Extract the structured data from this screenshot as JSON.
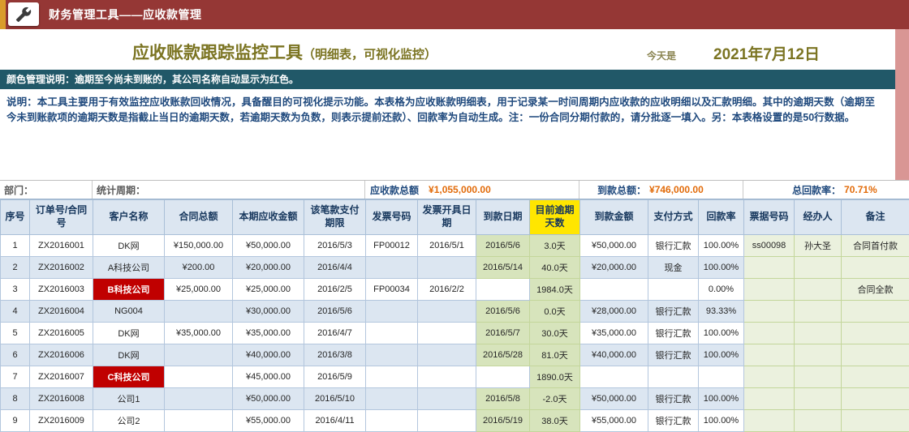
{
  "colors": {
    "topbar_bg": "#953735",
    "topbar_accent": "#D99C2B",
    "olive": "#7B7422",
    "teal": "#215868",
    "navy": "#1F497D",
    "orange": "#E26B0A",
    "header_bg": "#DCE6F1",
    "header_text": "#17375D",
    "overdue_yellow": "#FFE600",
    "stripe": "#DCE6F1",
    "green_dark": "#D7E4BC",
    "green_light": "#EBF1DE",
    "red_cell": "#C00000",
    "salmon": "#D99694"
  },
  "topbar": {
    "icon": "wrench-icon",
    "title": "财务管理工具——应收款管理"
  },
  "header": {
    "title_main": "应收账款跟踪监控工具",
    "title_sub": "（明细表，可视化监控）",
    "today_label": "今天是",
    "date": "2021年7月12日"
  },
  "note_bar": "颜色管理说明：逾期至今尚未到账的，其公司名称自动显示为红色。",
  "description": "说明：本工具主要用于有效监控应收账款回收情况，具备醒目的可视化提示功能。本表格为应收账款明细表，用于记录某一时间周期内应收款的应收明细以及汇款明细。其中的逾期天数（逾期至今未到账款项的逾期天数是指截止当日的逾期天数，若逾期天数为负数，则表示提前还款）、回款率为自动生成。注：一份合同分期付款的，请分批逐一填入。另：本表格设置的是50行数据。",
  "summary": {
    "department_label": "部门：",
    "period_label": "统计周期：",
    "receivable_total_label": "应收款总额",
    "receivable_total_value": "¥1,055,000.00",
    "received_total_label": "到款总额：",
    "received_total_value": "¥746,000.00",
    "collection_rate_label": "总回款率：",
    "collection_rate_value": "70.71%"
  },
  "table": {
    "headers": [
      "序号",
      "订单号/合同号",
      "客户名称",
      "合同总额",
      "本期应收金额",
      "该笔款支付期限",
      "发票号码",
      "发票开具日期",
      "到款日期",
      "目前逾期天数",
      "到款金额",
      "支付方式",
      "回款率",
      "票据号码",
      "经办人",
      "备注"
    ],
    "rows": [
      {
        "cells": [
          "1",
          "ZX2016001",
          "DK网",
          "¥150,000.00",
          "¥50,000.00",
          "2016/5/3",
          "FP00012",
          "2016/5/1",
          "2016/5/6",
          "3.0天",
          "¥50,000.00",
          "银行汇款",
          "100.00%",
          "ss00098",
          "孙大圣",
          "合同首付款"
        ],
        "customer_red": false
      },
      {
        "cells": [
          "2",
          "ZX2016002",
          "A科技公司",
          "¥200.00",
          "¥20,000.00",
          "2016/4/4",
          "",
          "",
          "2016/5/14",
          "40.0天",
          "¥20,000.00",
          "现金",
          "100.00%",
          "",
          "",
          ""
        ],
        "customer_red": false
      },
      {
        "cells": [
          "3",
          "ZX2016003",
          "B科技公司",
          "¥25,000.00",
          "¥25,000.00",
          "2016/2/5",
          "FP00034",
          "2016/2/2",
          "",
          "1984.0天",
          "",
          "",
          "0.00%",
          "",
          "",
          "合同全款"
        ],
        "customer_red": true
      },
      {
        "cells": [
          "4",
          "ZX2016004",
          "NG004",
          "",
          "¥30,000.00",
          "2016/5/6",
          "",
          "",
          "2016/5/6",
          "0.0天",
          "¥28,000.00",
          "银行汇款",
          "93.33%",
          "",
          "",
          ""
        ],
        "customer_red": false
      },
      {
        "cells": [
          "5",
          "ZX2016005",
          "DK网",
          "¥35,000.00",
          "¥35,000.00",
          "2016/4/7",
          "",
          "",
          "2016/5/7",
          "30.0天",
          "¥35,000.00",
          "银行汇款",
          "100.00%",
          "",
          "",
          ""
        ],
        "customer_red": false
      },
      {
        "cells": [
          "6",
          "ZX2016006",
          "DK网",
          "",
          "¥40,000.00",
          "2016/3/8",
          "",
          "",
          "2016/5/28",
          "81.0天",
          "¥40,000.00",
          "银行汇款",
          "100.00%",
          "",
          "",
          ""
        ],
        "customer_red": false
      },
      {
        "cells": [
          "7",
          "ZX2016007",
          "C科技公司",
          "",
          "¥45,000.00",
          "2016/5/9",
          "",
          "",
          "",
          "1890.0天",
          "",
          "",
          "",
          "",
          "",
          ""
        ],
        "customer_red": true
      },
      {
        "cells": [
          "8",
          "ZX2016008",
          "公司1",
          "",
          "¥50,000.00",
          "2016/5/10",
          "",
          "",
          "2016/5/8",
          "-2.0天",
          "¥50,000.00",
          "银行汇款",
          "100.00%",
          "",
          "",
          ""
        ],
        "customer_red": false
      },
      {
        "cells": [
          "9",
          "ZX2016009",
          "公司2",
          "",
          "¥55,000.00",
          "2016/4/11",
          "",
          "",
          "2016/5/19",
          "38.0天",
          "¥55,000.00",
          "银行汇款",
          "100.00%",
          "",
          "",
          ""
        ],
        "customer_red": false
      }
    ]
  }
}
